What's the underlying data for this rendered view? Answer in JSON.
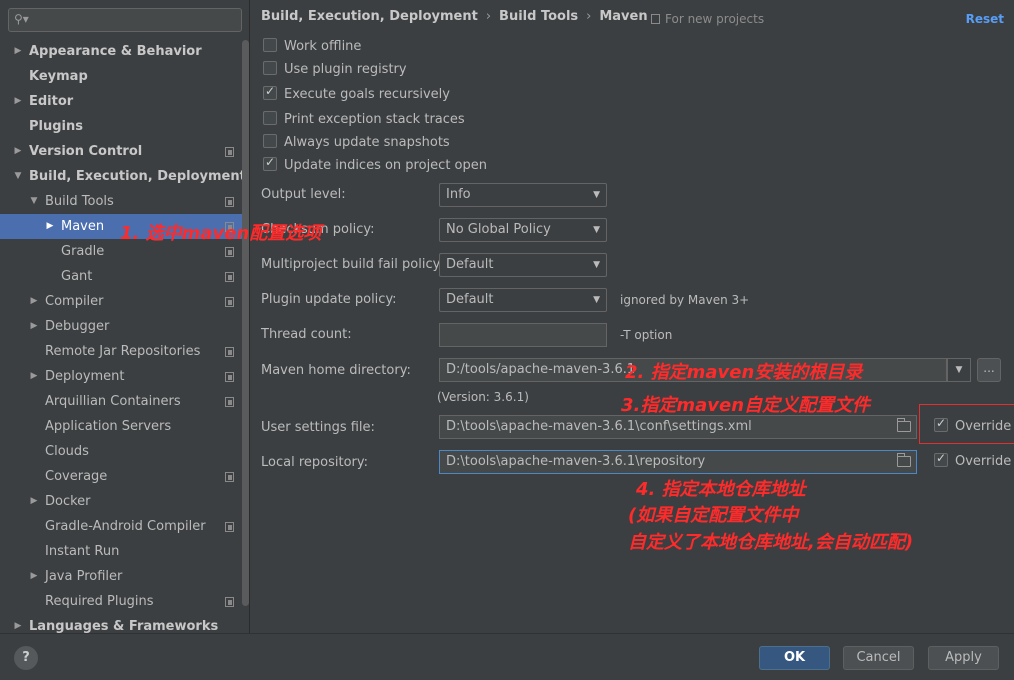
{
  "search": {
    "placeholder": ""
  },
  "sidebar": {
    "items": [
      {
        "label": "Appearance & Behavior"
      },
      {
        "label": "Keymap"
      },
      {
        "label": "Editor"
      },
      {
        "label": "Plugins"
      },
      {
        "label": "Version Control"
      },
      {
        "label": "Build, Execution, Deployment"
      },
      {
        "label": "Build Tools"
      },
      {
        "label": "Maven"
      },
      {
        "label": "Gradle"
      },
      {
        "label": "Gant"
      },
      {
        "label": "Compiler"
      },
      {
        "label": "Debugger"
      },
      {
        "label": "Remote Jar Repositories"
      },
      {
        "label": "Deployment"
      },
      {
        "label": "Arquillian Containers"
      },
      {
        "label": "Application Servers"
      },
      {
        "label": "Clouds"
      },
      {
        "label": "Coverage"
      },
      {
        "label": "Docker"
      },
      {
        "label": "Gradle-Android Compiler"
      },
      {
        "label": "Instant Run"
      },
      {
        "label": "Java Profiler"
      },
      {
        "label": "Required Plugins"
      },
      {
        "label": "Languages & Frameworks"
      }
    ]
  },
  "breadcrumb": {
    "a": "Build, Execution, Deployment",
    "b": "Build Tools",
    "c": "Maven",
    "sep": "›"
  },
  "header": {
    "for_new_projects": "For new projects",
    "reset": "Reset"
  },
  "checkboxes": [
    {
      "label": "Work offline",
      "checked": false
    },
    {
      "label": "Use plugin registry",
      "checked": false
    },
    {
      "label": "Execute goals recursively",
      "checked": true
    },
    {
      "label": "Print exception stack traces",
      "checked": false
    },
    {
      "label": "Always update snapshots",
      "checked": false
    },
    {
      "label": "Update indices on project open",
      "checked": true
    }
  ],
  "fields": {
    "output_level": {
      "label": "Output level:",
      "value": "Info"
    },
    "checksum_policy": {
      "label": "Checksum policy:",
      "value": "No Global Policy"
    },
    "multiproject": {
      "label": "Multiproject build fail policy:",
      "value": "Default"
    },
    "plugin_update": {
      "label": "Plugin update policy:",
      "value": "Default",
      "hint": "ignored by Maven 3+"
    },
    "thread_count": {
      "label": "Thread count:",
      "value": "",
      "hint": "-T option"
    },
    "maven_home": {
      "label": "Maven home directory:",
      "value": "D:/tools/apache-maven-3.6.1",
      "version": "(Version: 3.6.1)",
      "browse": "..."
    },
    "user_settings": {
      "label": "User settings file:",
      "value": "D:\\tools\\apache-maven-3.6.1\\conf\\settings.xml",
      "override_label": "Override",
      "override": true
    },
    "local_repo": {
      "label": "Local repository:",
      "value": "D:\\tools\\apache-maven-3.6.1\\repository",
      "override_label": "Override",
      "override": true
    }
  },
  "annotations": {
    "a1": "1. 选中maven配置选项",
    "a2": "2. 指定maven安装的根目录",
    "a3": "3.指定maven自定义配置文件",
    "a4_1": "4. 指定本地仓库地址",
    "a4_2": "(如果自定配置文件中",
    "a4_3": "自定义了本地仓库地址,会自动匹配)"
  },
  "footer": {
    "help": "?",
    "ok": "OK",
    "cancel": "Cancel",
    "apply": "Apply"
  },
  "colors": {
    "accent": "#4b6eaf",
    "annotation": "#ff2a2a",
    "link": "#589df6"
  }
}
